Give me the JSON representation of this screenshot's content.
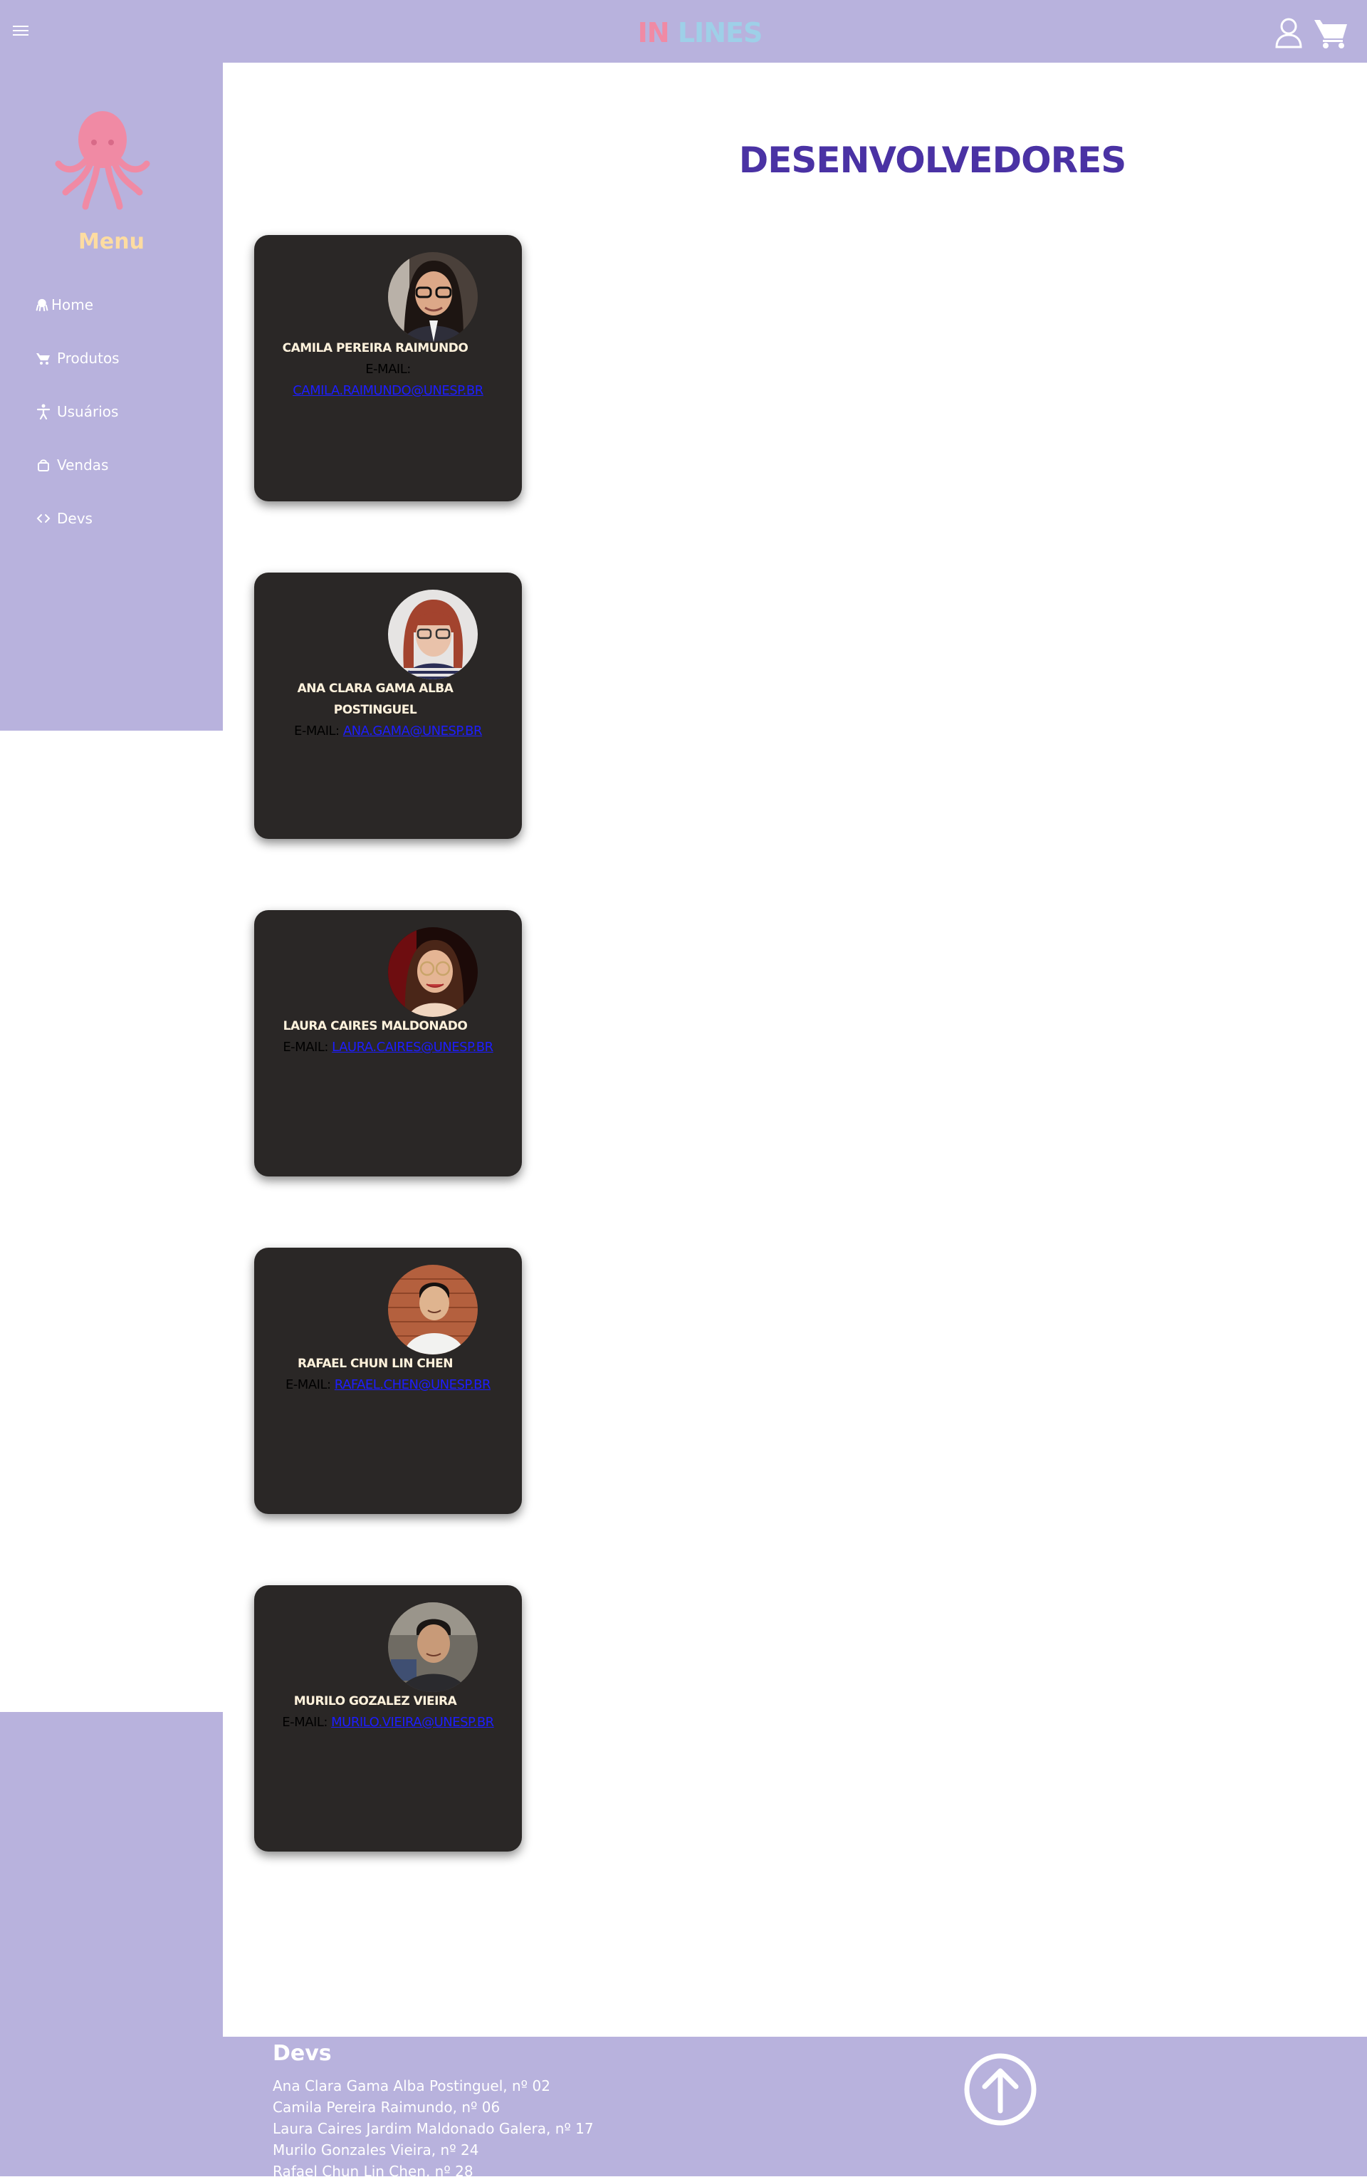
{
  "header": {
    "brand_part1": "IN",
    "brand_part2": "LINES",
    "icons": [
      "hamburger-icon",
      "user-icon",
      "cart-icon"
    ]
  },
  "sidebar": {
    "menu_title": "Menu",
    "items": [
      {
        "label": "Home",
        "icon": "octopus-icon"
      },
      {
        "label": "Produtos",
        "icon": "cart-icon"
      },
      {
        "label": "Usuários",
        "icon": "person-icon"
      },
      {
        "label": "Vendas",
        "icon": "shopping-bag-icon"
      },
      {
        "label": "Devs",
        "icon": "code-icon"
      }
    ]
  },
  "main": {
    "title": "DESENVOLVEDORES",
    "email_label": "E-MAIL:",
    "devs": [
      {
        "name": "CAMILA PEREIRA RAIMUNDO",
        "email": "CAMILA.RAIMUNDO@UNESP.BR"
      },
      {
        "name": "ANA CLARA GAMA ALBA POSTINGUEL",
        "email": "ANA.GAMA@UNESP.BR"
      },
      {
        "name": "LAURA CAIRES MALDONADO",
        "email": "LAURA.CAIRES@UNESP.BR"
      },
      {
        "name": "RAFAEL CHUN LIN CHEN",
        "email": "RAFAEL.CHEN@UNESP.BR"
      },
      {
        "name": "MURILO GOZALEZ VIEIRA",
        "email": "MURILO.VIEIRA@UNESP.BR"
      }
    ]
  },
  "footer": {
    "title": "Devs",
    "lines": [
      "Ana Clara Gama Alba Postinguel, nº 02",
      "Camila Pereira Raimundo, nº 06",
      "Laura Caires Jardim Maldonado Galera, nº 17",
      "Murilo Gonzales Vieira, nº 24",
      "Rafael Chun Lin Chen, nº 28"
    ]
  },
  "colors": {
    "lavender": "#b8b2dd",
    "title_purple": "#4a32a4",
    "octopus_pink": "#f08aa4",
    "menu_gold": "#fddca1",
    "card_dark": "#2a2726",
    "link_blue": "#1d1dff"
  }
}
